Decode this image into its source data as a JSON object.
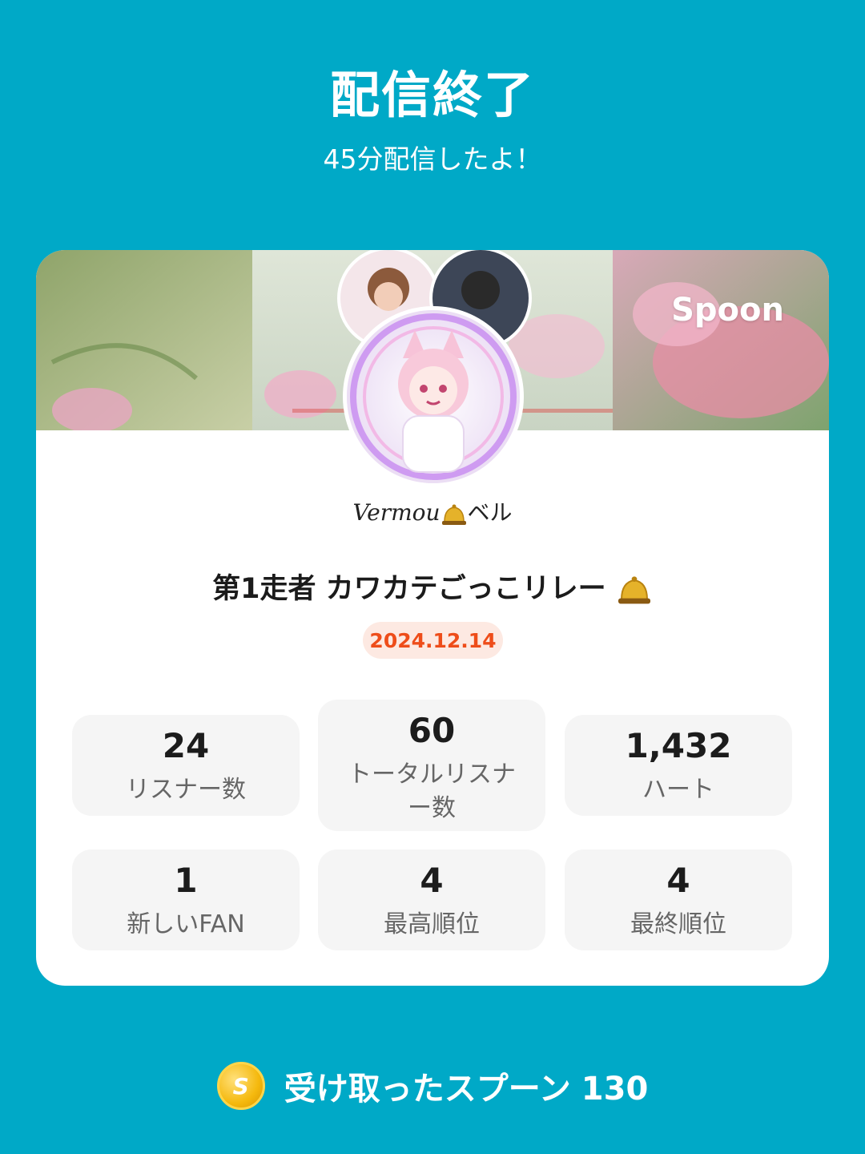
{
  "header": {
    "title": "配信終了",
    "subtitle": "45分配信したよ！"
  },
  "banner": {
    "brand": "Spoon"
  },
  "host": {
    "name": "Vermou",
    "name_suffix": "ベル",
    "avatar_icon": "host-avatar"
  },
  "room": {
    "title": "第1走者  カワカテごっこリレー",
    "date": "2024.12.14"
  },
  "stats": [
    {
      "value": "24",
      "label": "リスナー数"
    },
    {
      "value": "60",
      "label": "トータルリスナー数"
    },
    {
      "value": "1,432",
      "label": "ハート"
    },
    {
      "value": "1",
      "label": "新しいFAN"
    },
    {
      "value": "4",
      "label": "最高順位"
    },
    {
      "value": "4",
      "label": "最終順位"
    }
  ],
  "footer": {
    "coin_symbol": "S",
    "label": "受け取ったスプーン",
    "count": "130"
  },
  "colors": {
    "background": "#00a9c7",
    "date_accent": "#ee4d1a",
    "date_bg": "#fde9e2"
  }
}
